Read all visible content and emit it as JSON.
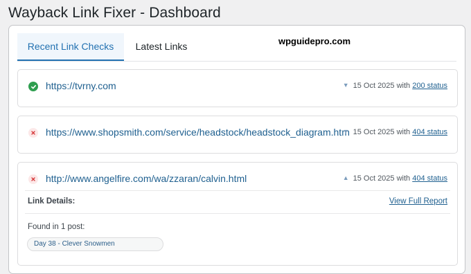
{
  "header": {
    "title": "Wayback Link Fixer - Dashboard"
  },
  "tabs": [
    {
      "label": "Recent Link Checks",
      "active": true
    },
    {
      "label": "Latest Links",
      "active": false
    }
  ],
  "watermark": "wpguidepro.com",
  "links": [
    {
      "url": "https://tvrny.com",
      "status_icon": "check-circle-icon",
      "caret": "▼",
      "date_text": "15 Oct 2025 with",
      "status_label": "200 status",
      "status_color": "#2e9e4f"
    },
    {
      "url": "https://www.shopsmith.com/service/headstock/headstock_diagram.htm",
      "status_icon": "error-x-icon",
      "caret": "▼",
      "date_text": "15 Oct 2025 with",
      "status_label": "404 status",
      "status_color": "#d63638"
    },
    {
      "url": "http://www.angelfire.com/wa/zzaran/calvin.html",
      "status_icon": "error-x-icon",
      "caret": "▲",
      "date_text": "15 Oct 2025 with",
      "status_label": "404 status",
      "status_color": "#d63638",
      "expanded": true,
      "details": {
        "label": "Link Details:",
        "report_link": "View Full Report",
        "found_label": "Found in 1 post:",
        "posts": [
          "Day 38 - Clever Snowmen"
        ]
      }
    }
  ],
  "colors": {
    "accent": "#2271b1",
    "link": "#1e5f8f",
    "tab_active_bg": "#f0f6fc"
  }
}
